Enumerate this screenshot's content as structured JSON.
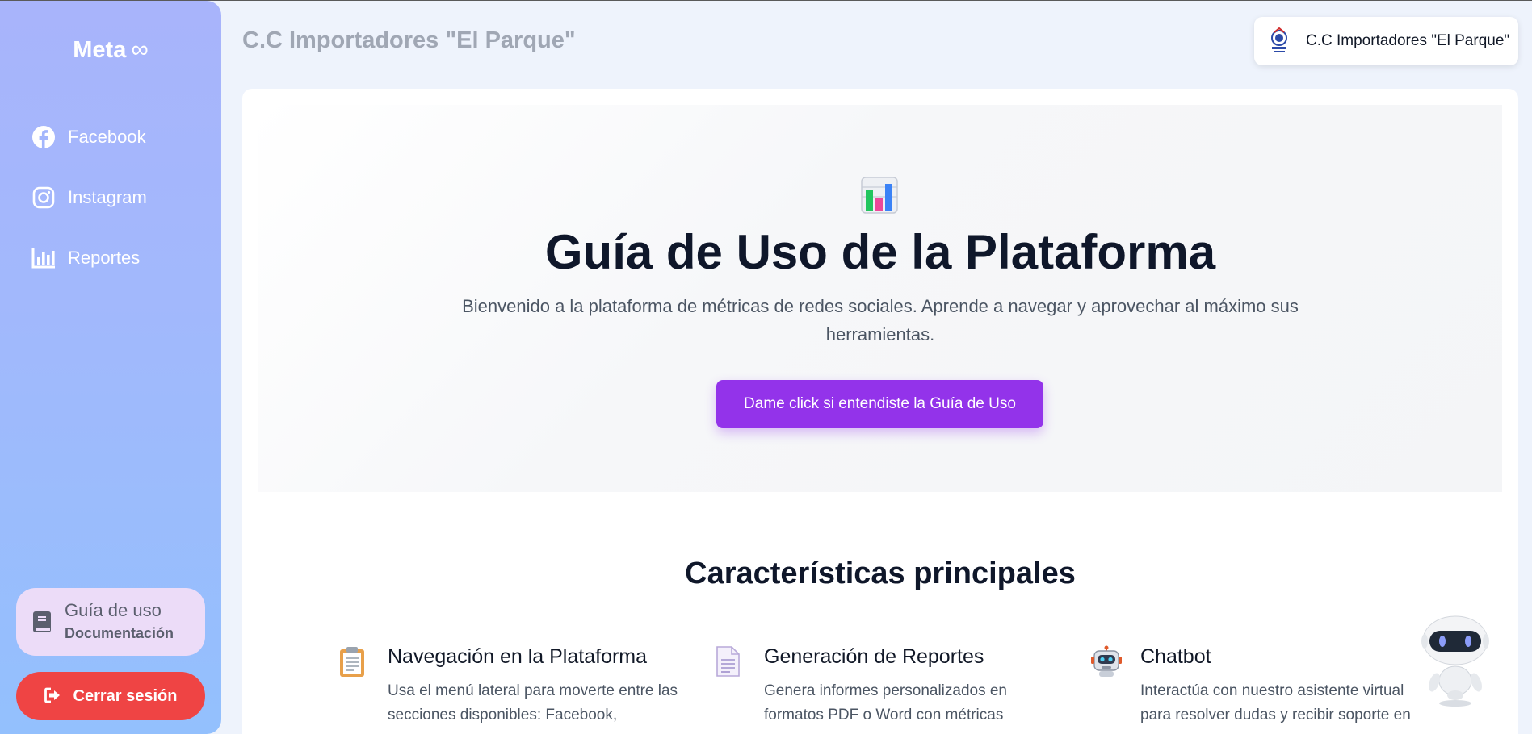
{
  "sidebar": {
    "brand": "Meta",
    "items": [
      {
        "label": "Facebook",
        "icon": "facebook-icon"
      },
      {
        "label": "Instagram",
        "icon": "instagram-icon"
      },
      {
        "label": "Reportes",
        "icon": "bar-chart-icon"
      }
    ],
    "guide": {
      "title": "Guía de uso",
      "subtitle": "Documentación",
      "icon": "book-icon"
    },
    "logout_label": "Cerrar sesión"
  },
  "header": {
    "title": "C.C Importadores \"El Parque\"",
    "company_name": "C.C Importadores \"El Parque\""
  },
  "hero": {
    "icon": "bar-chart-emoji-icon",
    "title": "Guía de Uso de la Plataforma",
    "description": "Bienvenido a la plataforma de métricas de redes sociales. Aprende a navegar y aprovechar al máximo sus herramientas.",
    "button_label": "Dame click si entendiste la Guía de Uso"
  },
  "features": {
    "title": "Características principales",
    "items": [
      {
        "title": "Navegación en la Plataforma",
        "text": "Usa el menú lateral para moverte entre las secciones disponibles: Facebook,",
        "icon": "clipboard-icon"
      },
      {
        "title": "Generación de Reportes",
        "text": "Genera informes personalizados en formatos PDF o Word con métricas",
        "icon": "document-icon"
      },
      {
        "title": "Chatbot",
        "text": "Interactúa con nuestro asistente virtual para resolver dudas y recibir soporte en",
        "icon": "robot-icon"
      }
    ]
  },
  "colors": {
    "accent": "#9333ea",
    "danger": "#ef4444",
    "sidebar_top": "#a8b4fb",
    "sidebar_bottom": "#93c0fd"
  }
}
